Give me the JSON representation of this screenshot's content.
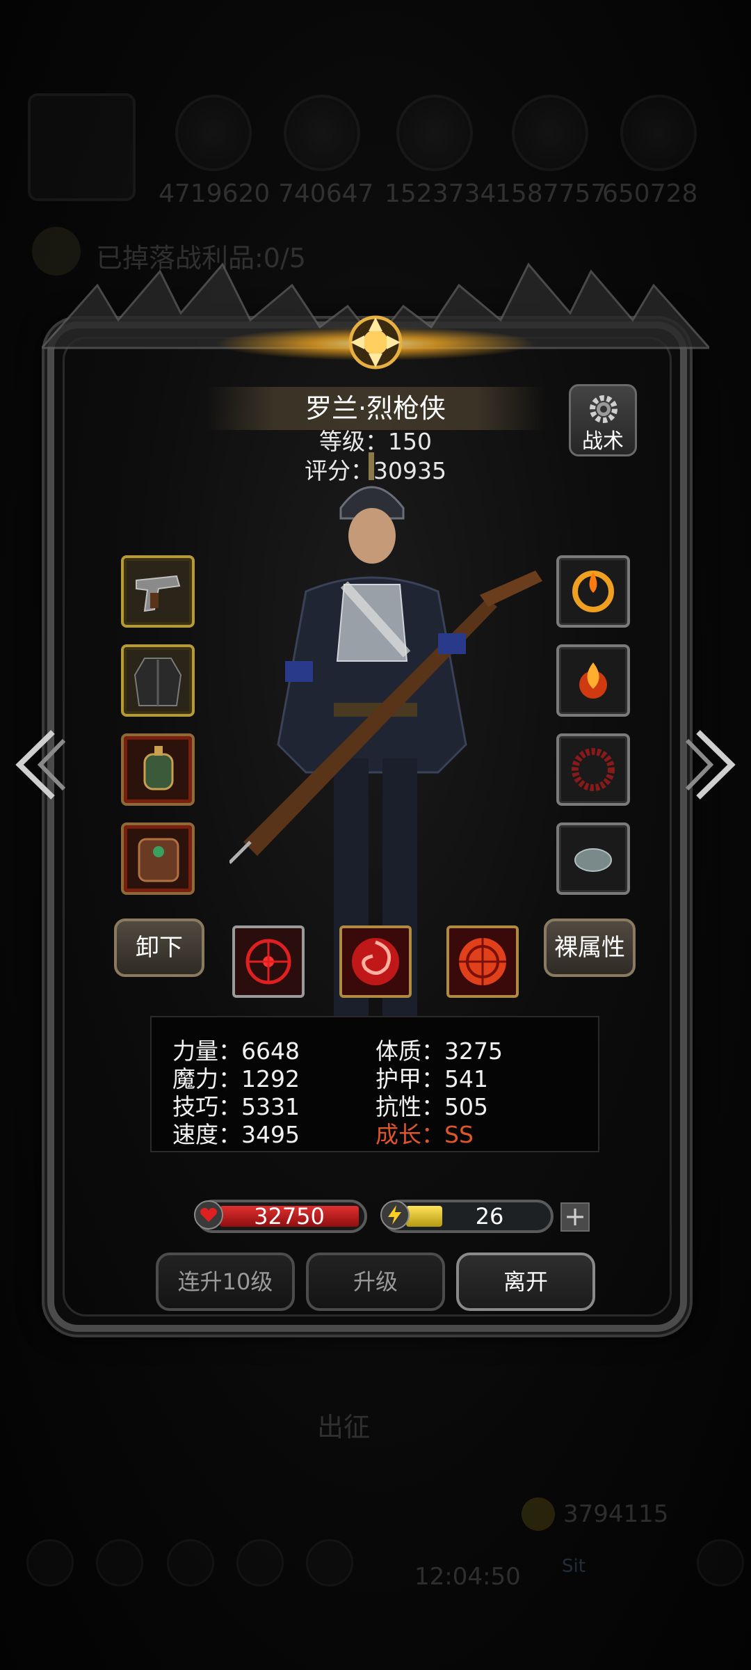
{
  "background": {
    "resources": [
      "4719620",
      "740647",
      "1523734",
      "1587757",
      "650728"
    ],
    "loot_text": "已掉落战利品:0/5",
    "expedition_label": "出征",
    "gold_amount": "3794115",
    "clock": "12:04:50",
    "chat_hint": "Sit"
  },
  "hero": {
    "name": "罗兰·烈枪侠",
    "level_text": "等级：150",
    "score_text": "评分：30935",
    "tactics_label": "战术"
  },
  "actions": {
    "unequip_label": "卸下",
    "base_attr_label": "裸属性"
  },
  "stats": {
    "strength": "力量：6648",
    "magic": "魔力：1292",
    "skill": "技巧：5331",
    "speed": "速度：3495",
    "constitution": "体质：3275",
    "armor": "护甲：541",
    "resistance": "抗性：505",
    "growth": "成长：SS"
  },
  "bars": {
    "hp_value": "32750",
    "energy_value": "26",
    "energy_fraction": 0.26,
    "plus_label": "+"
  },
  "buttons": {
    "level_up_10": "连升10级",
    "level_up": "升级",
    "leave": "离开"
  },
  "colors": {
    "growth": "#e0552a",
    "hp": "#c81e1e",
    "energy": "#e8c81e"
  }
}
